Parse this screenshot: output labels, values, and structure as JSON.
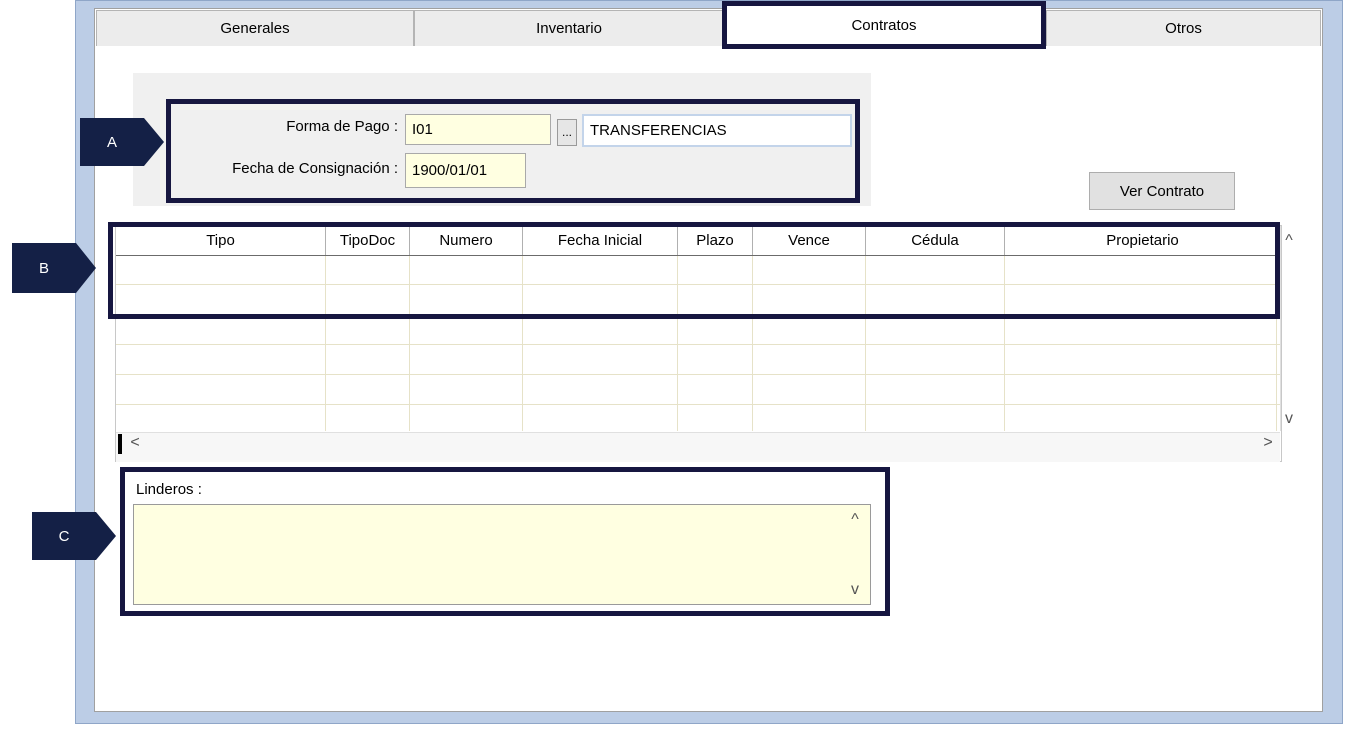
{
  "tabs": [
    {
      "label": "Generales",
      "active": false
    },
    {
      "label": "Inventario",
      "active": false
    },
    {
      "label": "Contratos",
      "active": true
    },
    {
      "label": "Otros",
      "active": false
    }
  ],
  "callouts": {
    "a": "A",
    "b": "B",
    "c": "C"
  },
  "payment": {
    "forma_label": "Forma de Pago :",
    "forma_code": "I01",
    "browse_label": "...",
    "forma_desc": "TRANSFERENCIAS",
    "fecha_label": "Fecha de Consignación :",
    "fecha_value": "1900/01/01"
  },
  "ver_contrato_label": "Ver Contrato",
  "grid": {
    "columns": [
      "Tipo",
      "TipoDoc",
      "Numero",
      "Fecha Inicial",
      "Plazo",
      "Vence",
      "Cédula",
      "Propietario"
    ],
    "rows": []
  },
  "scroll_glyphs": {
    "up": "^",
    "down": "v",
    "left": "<",
    "right": ">"
  },
  "linderos": {
    "label": "Linderos :",
    "value": ""
  },
  "colors": {
    "callout": "#142046",
    "highlight_box": "#161640",
    "field_bg": "#ffffe1",
    "frame": "#bccde6"
  }
}
